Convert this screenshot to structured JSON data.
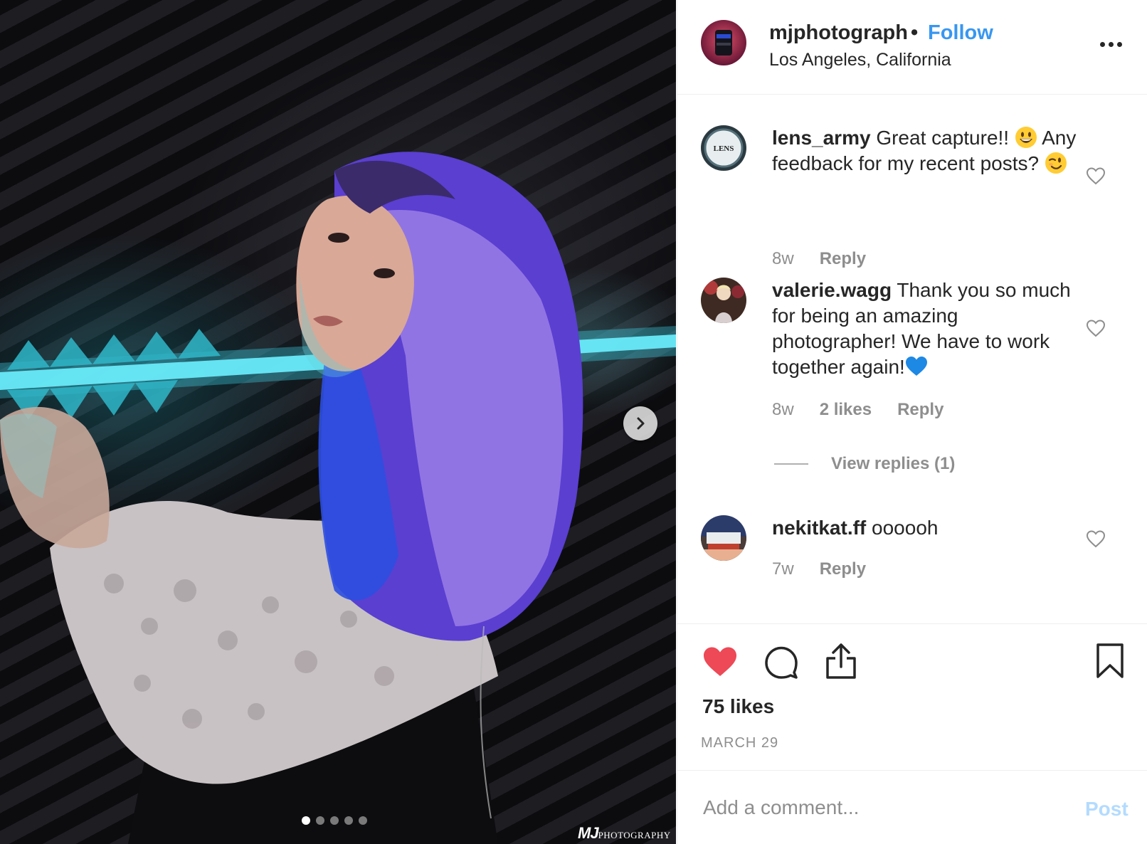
{
  "post": {
    "image_alt": "Portrait of a woman with blue and purple hair in front of a neon light bar",
    "watermark_brand": "MJ",
    "watermark_text": "PHOTOGRAPHY",
    "carousel_total": 5,
    "carousel_active_index": 0
  },
  "header": {
    "username": "mjphotograph",
    "separator": "•",
    "follow_label": "Follow",
    "location": "Los Angeles, California"
  },
  "comments": [
    {
      "username": "lens_army",
      "text_1": " Great capture!! ",
      "text_2": " Any feedback for my recent posts? ",
      "time": "8w",
      "reply_label": "Reply",
      "avatar_text": "LENS"
    },
    {
      "username": "valerie.wagg",
      "text_1": " Thank you so much for being an amazing photographer! We have to work together again!",
      "time": "8w",
      "likes": "2 likes",
      "reply_label": "Reply",
      "view_replies": "View replies (1)"
    },
    {
      "username": "nekitkat.ff",
      "text_1": " oooooh",
      "time": "7w",
      "reply_label": "Reply"
    }
  ],
  "actions": {
    "likes": "75 likes",
    "date": "MARCH 29",
    "liked": true
  },
  "add_comment": {
    "placeholder": "Add a comment...",
    "post_label": "Post"
  },
  "colors": {
    "accent": "#3897f0",
    "heart": "#ed4956",
    "muted": "#8e8e8e",
    "post_disabled": "#b3dbff"
  }
}
